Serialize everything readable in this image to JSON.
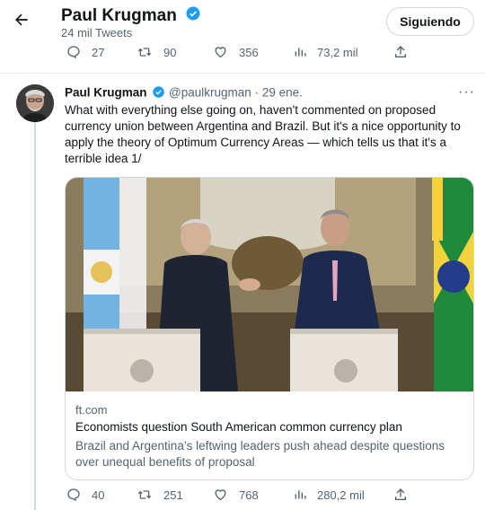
{
  "header": {
    "back_icon": "arrow-left-icon",
    "name": "Paul Krugman",
    "tweet_count": "24 mil Tweets",
    "follow_label": "Siguiendo"
  },
  "top_actions": {
    "replies": "27",
    "retweets": "90",
    "likes": "356",
    "views": "73,2 mil"
  },
  "tweet": {
    "name": "Paul Krugman",
    "handle": "@paulkrugman",
    "separator": "·",
    "date": "29 ene.",
    "more_icon": "more-horizontal-icon",
    "text": "What with everything else going on, haven't commented on proposed currency union between Argentina and Brazil. But it's a nice opportunity to apply the theory of Optimum Currency Areas — which tells us that it's a terrible idea 1/",
    "card": {
      "domain": "ft.com",
      "title": "Economists question South American common currency plan",
      "description": "Brazil and Argentina’s leftwing leaders push ahead despite questions over unequal benefits of proposal"
    },
    "actions": {
      "replies": "40",
      "retweets": "251",
      "likes": "768",
      "views": "280,2 mil"
    }
  },
  "colors": {
    "verified": "#1d9bf0",
    "secondary_text": "#536471",
    "border": "#cfd9de"
  }
}
